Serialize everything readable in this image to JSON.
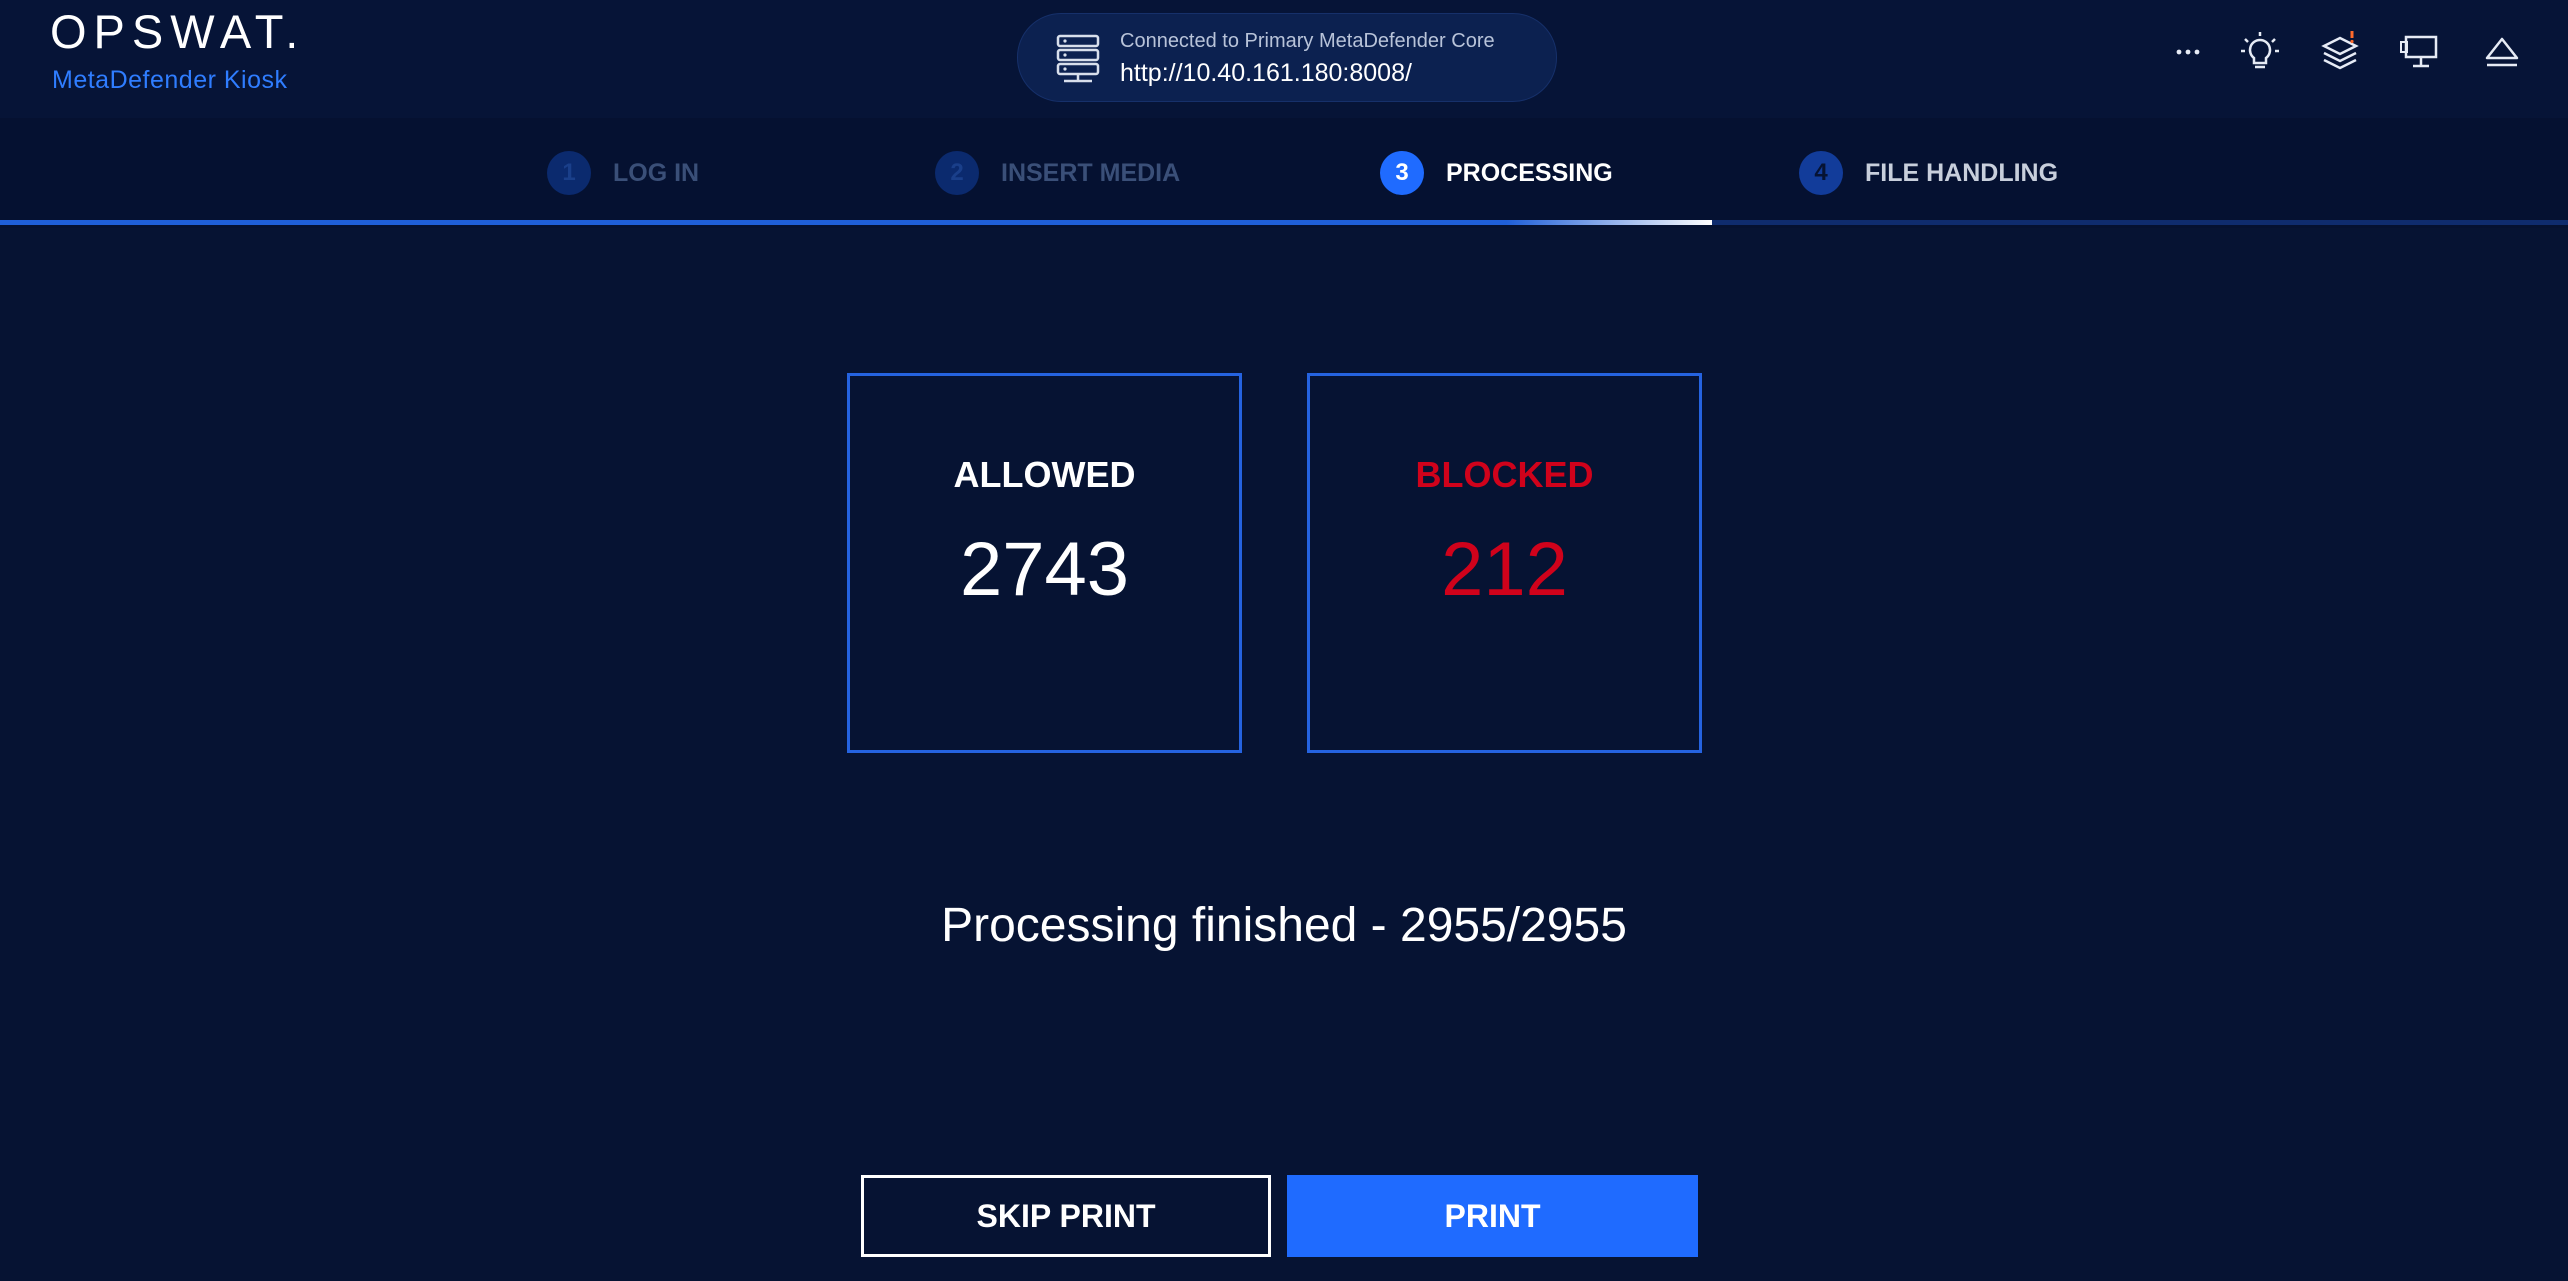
{
  "header": {
    "logo_text": "OPSWAT.",
    "product_name": "MetaDefender Kiosk",
    "connection": {
      "label": "Connected to Primary MetaDefender Core",
      "url": "http://10.40.161.180:8008/",
      "icon": "server-icon"
    },
    "icons": [
      "more-icon",
      "lightbulb-icon",
      "layers-alert-icon",
      "kiosk-monitor-icon",
      "eject-icon"
    ]
  },
  "steps": [
    {
      "number": "1",
      "label": "LOG IN",
      "state": "done"
    },
    {
      "number": "2",
      "label": "INSERT MEDIA",
      "state": "done"
    },
    {
      "number": "3",
      "label": "PROCESSING",
      "state": "active"
    },
    {
      "number": "4",
      "label": "FILE HANDLING",
      "state": "todo"
    }
  ],
  "stats": {
    "allowed": {
      "label": "ALLOWED",
      "value": "2743"
    },
    "blocked": {
      "label": "BLOCKED",
      "value": "212"
    }
  },
  "status": {
    "text": "Processing finished - 2955/2955"
  },
  "actions": {
    "skip_print_label": "SKIP PRINT",
    "print_label": "PRINT"
  },
  "colors": {
    "background": "#061333",
    "accent": "#1f6bff",
    "card_border": "#2563e0",
    "blocked": "#d0021b",
    "brand_sub": "#2f7dff"
  }
}
